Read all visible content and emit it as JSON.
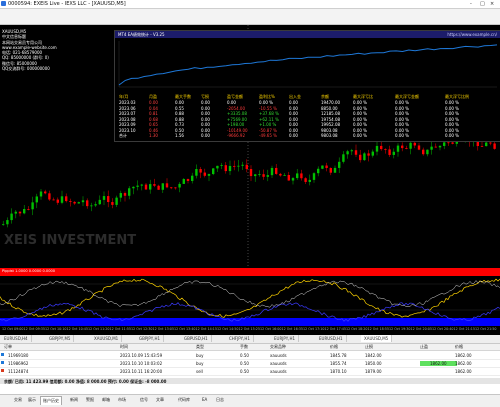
{
  "window": {
    "title": "0000594: EXEIS Live - IEXS LLC - [XAUUSD,M5]",
    "controls": [
      "-",
      "□",
      "×"
    ]
  },
  "chart": {
    "symbol_label": "XAUUSD,M5",
    "info_lines": [
      "中文信息标题",
      "本网站交易员专用公司",
      "www.example-website.com",
      "电话: 021-68579000",
      "QQ: 85000000 (群号: 0)",
      "微信号: 85000000",
      "QQ交流群号: 000000000"
    ],
    "watermark": "XEIS INVESTMENT",
    "info_window": {
      "title": "MT4 EA绩效统计 - V3.25",
      "right_note": "https://www.example.cn/",
      "columns": [
        "年/月",
        "月盈",
        "最大手数",
        "亏损",
        "盈亏金额",
        "盈利比%",
        "出入金",
        "余额",
        "最大浮亏比",
        "最大浮亏金额",
        "最大浮亏比例"
      ],
      "rows": [
        [
          "2023.03",
          "0.00",
          "0.00",
          "0.00",
          "0.00",
          "0.00 %",
          "0.00",
          "19470.00",
          "0.00 %",
          "0.00 %",
          "0.00 %"
        ],
        [
          "2023.06",
          "0.04",
          "0.55",
          "0.00",
          "-2054.00",
          "-10.55 %",
          "0.00",
          "8850.00",
          "0.00 %",
          "0.00 %",
          "0.00 %"
        ],
        [
          "2023.07",
          "0.81",
          "0.88",
          "0.00",
          "+3335.08",
          "+37.68 %",
          "0.00",
          "12185.08",
          "0.00 %",
          "0.00 %",
          "0.00 %"
        ],
        [
          "2023.08",
          "0.68",
          "0.88",
          "0.00",
          "+7569.00",
          "+62.11 %",
          "0.00",
          "19754.08",
          "0.00 %",
          "0.00 %",
          "0.00 %"
        ],
        [
          "2023.09",
          "0.65",
          "0.73",
          "0.00",
          "+198.00",
          "+1.00 %",
          "0.00",
          "19952.08",
          "0.00 %",
          "0.00 %",
          "0.00 %"
        ],
        [
          "2023.10",
          "0.46",
          "0.50",
          "0.00",
          "-10149.00",
          "-50.87 %",
          "0.00",
          "9803.08",
          "0.00 %",
          "0.00 %",
          "0.00 %"
        ],
        [
          "合计",
          "1.30",
          "1.56",
          "0.00",
          "-9666.92",
          "-49.65 %",
          "0.00",
          "9803.08",
          "0.00 %",
          "0.00 %",
          "0.00 %"
        ]
      ]
    },
    "indicator_title": "Pippist 1.0000 0.0000 0.0000",
    "time_axis": [
      "12 Oct 09:00",
      "12 Oct 09:35",
      "12 Oct 10:10",
      "12 Oct 10:45",
      "12 Oct 11:20",
      "12 Oct 11:55",
      "12 Oct 12:30",
      "12 Oct 13:05",
      "12 Oct 13:40",
      "12 Oct 14:15",
      "12 Oct 14:50",
      "12 Oct 15:25",
      "12 Oct 16:00",
      "12 Oct 16:35",
      "12 Oct 17:10",
      "12 Oct 17:45",
      "12 Oct 18:20",
      "12 Oct 18:55",
      "12 Oct 19:30",
      "12 Oct 20:05",
      "12 Oct 20:40",
      "12 Oct 21:15",
      "12 Oct 21:50"
    ]
  },
  "symbol_tabs": [
    "EURUSD,H4",
    "GBPJPY,M5",
    "XAUUSD,M1",
    "GBPJPY,H1",
    "GBPUSD,H1",
    "CHFJPY,H1",
    "EURJPY,H1",
    "EURUSD,H1",
    "XAUUSD,M5"
  ],
  "trade": {
    "columns": [
      "订单",
      "时间",
      "类型",
      "手数",
      "交易品种",
      "价格",
      "止损",
      "止盈",
      "价格"
    ],
    "rows": [
      {
        "order": "11969180",
        "time": "2023.10.09 15:43:59",
        "type": "buy",
        "lots": "0.50",
        "symbol": "xauusds",
        "price": "1845.78",
        "sl": "1842.00",
        "tp": "",
        "current": "1862.00"
      },
      {
        "order": "11986962",
        "time": "2023.10.10 10:03:02",
        "type": "buy",
        "lots": "0.50",
        "symbol": "xauusds",
        "price": "1855.74",
        "sl": "1850.00",
        "tp": "1862.00",
        "current": "1862.00"
      },
      {
        "order": "11124874",
        "time": "2023.10.11 16:20:00",
        "type": "sell",
        "lots": "0.50",
        "symbol": "xauusds",
        "price": "1870.10",
        "sl": "1879.00",
        "tp": "",
        "current": "1862.00"
      }
    ],
    "balance_line": "余额/ 已用: 11 423.99 信用额: 0.00 净值: 8 000.00 预付: 0.00 保证金: -8 000.00"
  },
  "bottom_tabs": [
    "交易",
    "展示",
    "账户历史",
    "新闻",
    "警报",
    "邮箱",
    "市场",
    "信号",
    "文章",
    "代码库",
    "EA",
    "日志"
  ],
  "bottom_active": "账户历史",
  "colors": {
    "bull": "#00c000",
    "bear": "#ff0000",
    "indicator_band": "#ff0000",
    "info_header": "#1c1c6a",
    "equity_line": "#1e78d8"
  }
}
